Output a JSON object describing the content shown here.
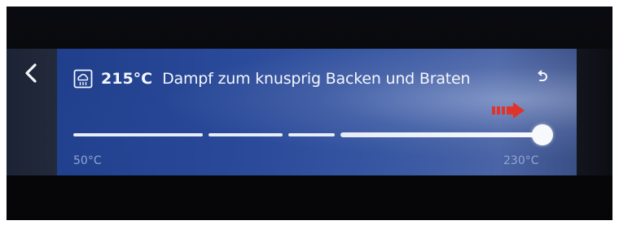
{
  "navigation": {
    "back_icon": "chevron-left-icon"
  },
  "header": {
    "mode_icon": "steam-oven-icon",
    "temperature": "215°C",
    "mode_label": "Dampf zum knusprig Backen und Braten",
    "reset_icon": "undo-icon"
  },
  "slider": {
    "min_label": "50°C",
    "max_label": "230°C",
    "value_fraction": 1.0,
    "hint_icon": "swipe-right-arrow-icon",
    "hint_color": "#e0342b"
  },
  "colors": {
    "panel_accent": "#2a4a9a",
    "text": "#f4f6fb",
    "scale_label": "#93a6cf"
  }
}
